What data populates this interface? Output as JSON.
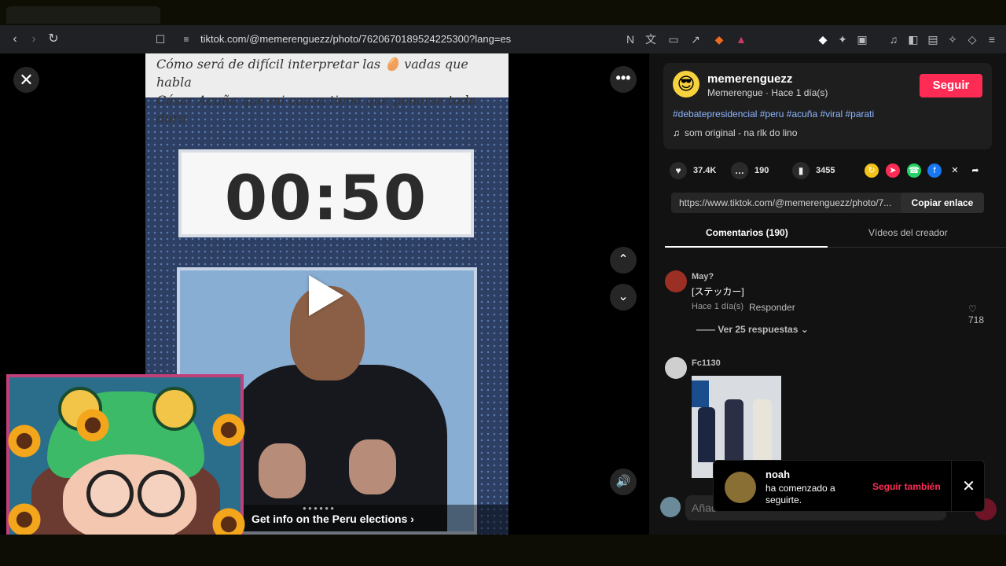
{
  "browser": {
    "url": "tiktok.com/@memerenguezz/photo/7620670189524225300?lang=es"
  },
  "viewer": {
    "caption_line1": "Cómo será de difícil interpretar las 🥚 vadas que habla",
    "caption_line2": "César Acuña que mi causa tiene que ponerse todo duro",
    "timer": "00:50",
    "elections_link": "Get info on the Peru elections",
    "elections_chevron": "›"
  },
  "post": {
    "username": "memerenguezz",
    "subtitle": "Memerengue · Hace 1 día(s)",
    "follow_label": "Seguir",
    "hashtags": "#debatepresidencial #peru #acuña #viral #parati",
    "sound": "som original - na rlk do lino",
    "likes": "37.4K",
    "comments": "190",
    "saves": "3455",
    "share_link": "https://www.tiktok.com/@memerenguezz/photo/7...",
    "copy_label": "Copiar enlace"
  },
  "tabs": {
    "comments": "Comentarios (190)",
    "creator": "Vídeos del creador"
  },
  "comments": [
    {
      "user": "May?",
      "text": "[ステッカー]",
      "time": "Hace 1 día(s)",
      "reply": "Responder",
      "likes": "♡ 718",
      "more": "—— Ver 25 respuestas ⌄"
    },
    {
      "user": "Fc1130"
    }
  ],
  "toast": {
    "name": "noah",
    "message": "ha comenzado a seguirte.",
    "follow": "Seguir también"
  },
  "comment_input": {
    "placeholder": "Añadir comentario..."
  },
  "colors": {
    "brand": "#fe2c55",
    "hashtag": "#8fb7ff"
  }
}
